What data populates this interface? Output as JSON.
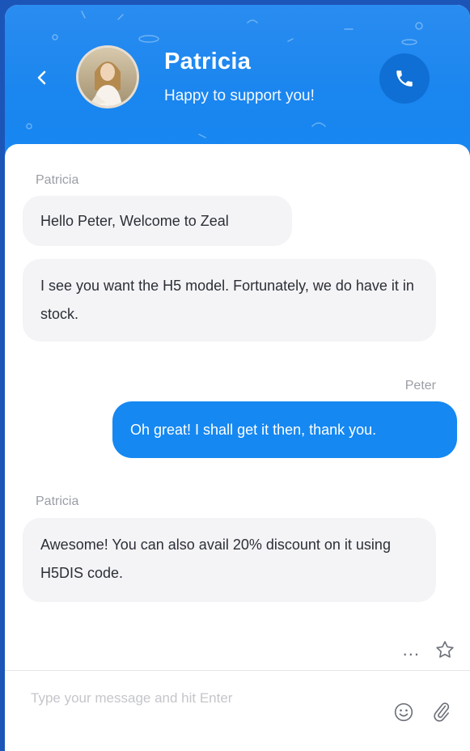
{
  "colors": {
    "page_background": "#1c55b8",
    "header_blue": "#1a86ef",
    "call_button": "#0f6fd4",
    "outgoing_bubble": "#1588f2",
    "incoming_bubble": "#f4f4f6",
    "sender_label": "#9a9ea6"
  },
  "header": {
    "back_icon": "chevron-left-icon",
    "agent_name": "Patricia",
    "agent_status": "Happy to support you!",
    "call_icon": "phone-icon"
  },
  "messages": [
    {
      "sender": "Patricia",
      "direction": "incoming",
      "bubbles": [
        {
          "text": "Hello Peter, Welcome to Zeal"
        },
        {
          "text": "I see you want the H5 model. Fortunately, we do have it in stock."
        }
      ]
    },
    {
      "sender": "Peter",
      "direction": "outgoing",
      "bubbles": [
        {
          "text": "Oh great! I shall get it then, thank you."
        }
      ]
    },
    {
      "sender": "Patricia",
      "direction": "incoming",
      "bubbles": [
        {
          "text": "Awesome! You can also avail 20% discount on it using H5DIS code."
        }
      ]
    }
  ],
  "actions": {
    "more_label": "...",
    "more_icon": "more-icon",
    "star_icon": "star-icon"
  },
  "composer": {
    "placeholder": "Type your message and hit Enter",
    "value": "",
    "emoji_icon": "emoji-icon",
    "attach_icon": "paperclip-icon"
  }
}
